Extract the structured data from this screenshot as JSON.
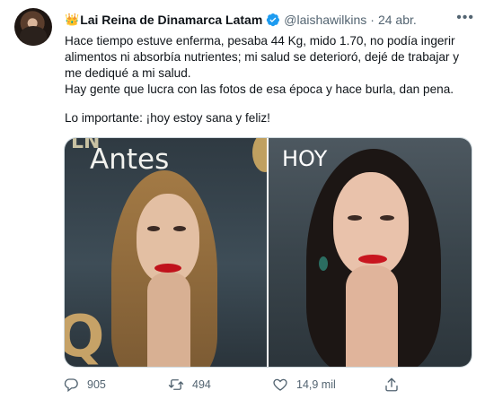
{
  "tweet": {
    "author": {
      "name": "Lai Reina de Dinamarca Latam",
      "name_emoji": "👑",
      "handle": "@laishawilkins",
      "date": "24 abr."
    },
    "text_lines": [
      "Hace tiempo estuve enferma, pesaba 44 Kg, mido 1.70, no podía ingerir alimentos ni absorbía nutrientes; mi salud se deterioró, dejé de trabajar y me dediqué a mi salud.",
      "Hay gente que lucra con las fotos de esa época y hace burla, dan pena.",
      "Lo importante: ¡hoy estoy sana y feliz!"
    ],
    "media": {
      "left_label": "Antes",
      "left_deco": "LN",
      "right_label": "HOY"
    },
    "actions": {
      "replies": "905",
      "retweets": "494",
      "likes": "14,9 mil"
    }
  },
  "colors": {
    "text": "#0f1419",
    "muted": "#536471",
    "verified": "#1d9bf0",
    "border": "#cfd9de"
  }
}
